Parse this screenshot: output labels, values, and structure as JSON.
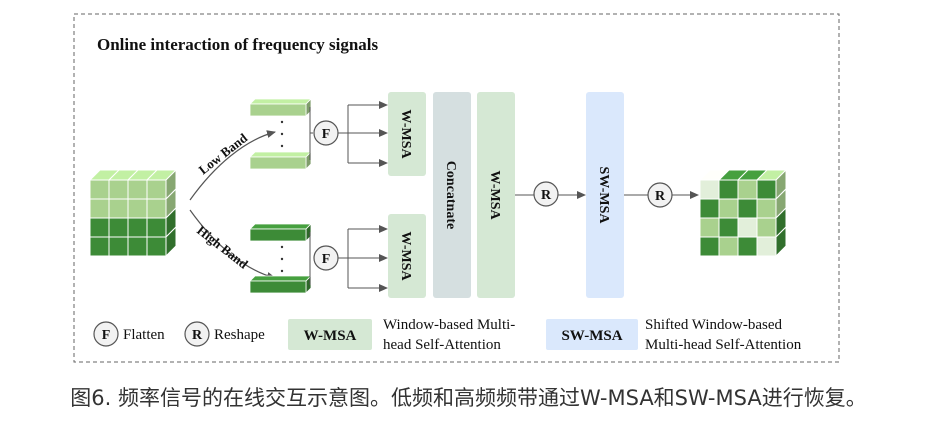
{
  "title": "Online interaction of frequency signals",
  "branches": {
    "low": "Low Band",
    "high": "High Band"
  },
  "ops": {
    "flatten_symbol": "F",
    "reshape_symbol": "R"
  },
  "blocks": {
    "wmsa_low": "W-MSA",
    "wmsa_high": "W-MSA",
    "concatenate": "Concatnate",
    "wmsa_mid": "W-MSA",
    "swmsa": "SW-MSA"
  },
  "legend": {
    "flatten_symbol": "F",
    "flatten_label": "Flatten",
    "reshape_symbol": "R",
    "reshape_label": "Reshape",
    "wmsa_label": "W-MSA",
    "wmsa_desc_line1": "Window-based Multi-",
    "wmsa_desc_line2": "head Self-Attention",
    "swmsa_label": "SW-MSA",
    "swmsa_desc_line1": "Shifted Window-based",
    "swmsa_desc_line2": "Multi-head Self-Attention"
  },
  "caption": "图6. 频率信号的在线交互示意图。低频和高频频带通过W-MSA和SW-MSA进行恢复。",
  "colors": {
    "wmsa_fill": "#d5e8d4",
    "swmsa_fill": "#dae8fc",
    "concat_fill": "#d5dfe0",
    "cube_dark": "#3d8b37",
    "cube_light": "#a9d18e",
    "cube_pale": "#e2efda",
    "border": "#555555"
  }
}
